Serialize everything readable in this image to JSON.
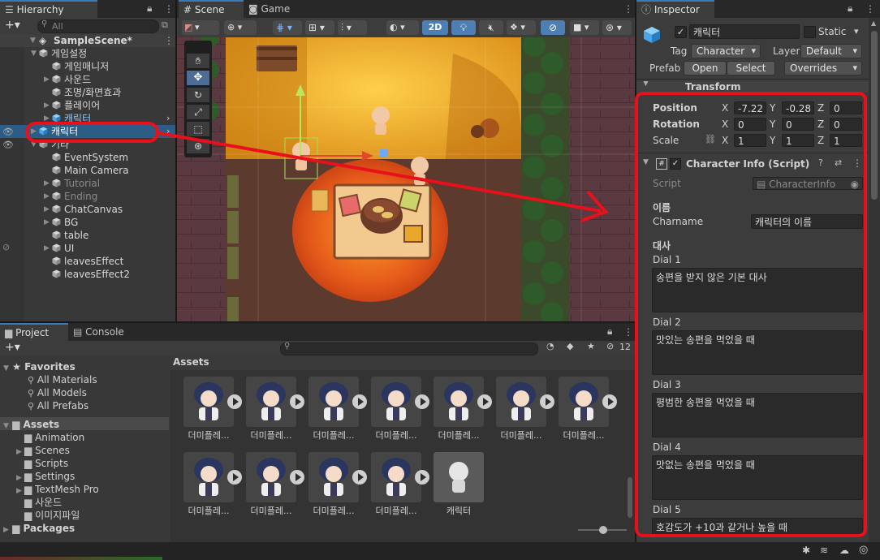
{
  "hierarchy": {
    "tab": "Hierarchy",
    "search_placeholder": "All",
    "scene": "SampleScene*",
    "items": [
      {
        "label": "게임설정",
        "indent": 1,
        "arrow": "▼",
        "dim": false
      },
      {
        "label": "게임매니저",
        "indent": 2,
        "arrow": "",
        "dim": false
      },
      {
        "label": "사운드",
        "indent": 2,
        "arrow": "▶",
        "dim": false
      },
      {
        "label": "조명/화면효과",
        "indent": 2,
        "arrow": "",
        "dim": false
      },
      {
        "label": "플레이어",
        "indent": 2,
        "arrow": "▶",
        "dim": false
      },
      {
        "label": "캐릭터",
        "indent": 2,
        "arrow": "▶",
        "dim": false,
        "prefab": true
      },
      {
        "label": "캐릭터",
        "indent": 1,
        "arrow": "▶",
        "dim": false,
        "prefab": true,
        "selected": true
      },
      {
        "label": "기타",
        "indent": 1,
        "arrow": "▼",
        "dim": false
      },
      {
        "label": "EventSystem",
        "indent": 2,
        "arrow": "",
        "dim": false
      },
      {
        "label": "Main Camera",
        "indent": 2,
        "arrow": "",
        "dim": false
      },
      {
        "label": "Tutorial",
        "indent": 2,
        "arrow": "▶",
        "dim": true
      },
      {
        "label": "Ending",
        "indent": 2,
        "arrow": "▶",
        "dim": true
      },
      {
        "label": "ChatCanvas",
        "indent": 2,
        "arrow": "▶",
        "dim": false
      },
      {
        "label": "BG",
        "indent": 2,
        "arrow": "▶",
        "dim": false
      },
      {
        "label": "table",
        "indent": 2,
        "arrow": "",
        "dim": false
      },
      {
        "label": "UI",
        "indent": 2,
        "arrow": "▶",
        "dim": false
      },
      {
        "label": "leavesEffect",
        "indent": 2,
        "arrow": "",
        "dim": false
      },
      {
        "label": "leavesEffect2",
        "indent": 2,
        "arrow": "",
        "dim": false
      }
    ]
  },
  "scene": {
    "tabs": [
      "Scene",
      "Game"
    ],
    "mode2d": "2D"
  },
  "inspector": {
    "tab": "Inspector",
    "object_name": "캐릭터",
    "static_label": "Static",
    "tag_label": "Tag",
    "tag_value": "Character",
    "layer_label": "Layer",
    "layer_value": "Default",
    "prefab_label": "Prefab",
    "open_btn": "Open",
    "select_btn": "Select",
    "overrides_btn": "Overrides",
    "transform_title": "Transform",
    "position_label": "Position",
    "rotation_label": "Rotation",
    "scale_label": "Scale",
    "axis_x": "X",
    "axis_y": "Y",
    "axis_z": "Z",
    "position": [
      "-7.22",
      "-0.28",
      "0"
    ],
    "rotation": [
      "0",
      "0",
      "0"
    ],
    "scale": [
      "1",
      "1",
      "1"
    ],
    "component_title": "Character Info (Script)",
    "script_label": "Script",
    "script_value": "CharacterInfo",
    "section_name": "이름",
    "charname_label": "Charname",
    "charname_value": "캐릭터의 이름",
    "section_dial": "대사",
    "dials": [
      {
        "label": "Dial 1",
        "value": "송편을 받지 않은 기본 대사"
      },
      {
        "label": "Dial 2",
        "value": "맛있는 송편을 먹었을 때"
      },
      {
        "label": "Dial 3",
        "value": "평범한 송편을 먹었을 때"
      },
      {
        "label": "Dial 4",
        "value": "맛없는 송편을 먹었을 때"
      },
      {
        "label": "Dial 5",
        "value": "호감도가 +10과 같거나 높을 때"
      }
    ]
  },
  "project": {
    "tabs": [
      "Project",
      "Console"
    ],
    "favorites_label": "Favorites",
    "favorites": [
      "All Materials",
      "All Models",
      "All Prefabs"
    ],
    "assets_label": "Assets",
    "folders": [
      "Animation",
      "Scenes",
      "Scripts",
      "Settings",
      "TextMesh Pro",
      "사운드",
      "이미지파일"
    ],
    "folder_arrows": [
      false,
      true,
      false,
      true,
      true,
      false,
      false
    ],
    "packages_label": "Packages",
    "breadcrumb": "Assets",
    "hidden_count": "12",
    "assets": [
      "더미플레...",
      "더미플레...",
      "더미플레...",
      "더미플레...",
      "더미플레...",
      "더미플레...",
      "더미플레...",
      "더미플레...",
      "더미플레...",
      "더미플레...",
      "더미플레...",
      "캐릭터"
    ]
  },
  "colors": {
    "highlight": "#e8101a",
    "selection": "#2c5d87",
    "accent": "#3a79bb"
  }
}
